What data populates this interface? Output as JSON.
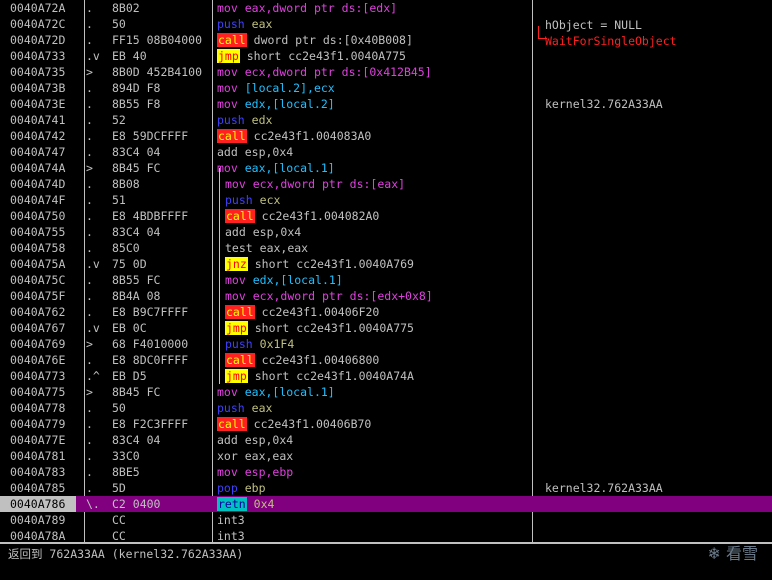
{
  "rows": [
    {
      "addr": "0040A72A",
      "mark": ".",
      "hex": "8B02",
      "mn": "mov",
      "ops": "eax,dword ptr ds:[edx]",
      "cls": "mov",
      "cmt": ""
    },
    {
      "addr": "0040A72C",
      "mark": ".",
      "hex": "50",
      "mn": "push",
      "ops": "eax",
      "cls": "push",
      "cmt": ""
    },
    {
      "addr": "0040A72D",
      "mark": ".",
      "hex": "FF15 08B04000",
      "mn": "call",
      "ops": "dword ptr ds:[0x40B008]",
      "cls": "call",
      "cmt": ""
    },
    {
      "addr": "0040A733",
      "mark": ".v",
      "hex": "EB 40",
      "mn": "jmp",
      "ops": "short cc2e43f1.0040A775",
      "cls": "jmp",
      "cmt": ""
    },
    {
      "addr": "0040A735",
      "mark": ">",
      "hex": "8B0D 452B4100",
      "mn": "mov",
      "ops": "ecx,dword ptr ds:[0x412B45]",
      "cls": "mov",
      "cmt": ""
    },
    {
      "addr": "0040A73B",
      "mark": ".",
      "hex": "894D F8",
      "mn": "mov",
      "ops": "[local.2],ecx",
      "cls": "mov",
      "cmt": ""
    },
    {
      "addr": "0040A73E",
      "mark": ".",
      "hex": "8B55 F8",
      "mn": "mov",
      "ops": "edx,[local.2]",
      "cls": "mov",
      "cmt": "kernel32.762A33AA"
    },
    {
      "addr": "0040A741",
      "mark": ".",
      "hex": "52",
      "mn": "push",
      "ops": "edx",
      "cls": "push",
      "cmt": ""
    },
    {
      "addr": "0040A742",
      "mark": ".",
      "hex": "E8 59DCFFFF",
      "mn": "call",
      "ops": "cc2e43f1.004083A0",
      "cls": "call",
      "cmt": ""
    },
    {
      "addr": "0040A747",
      "mark": ".",
      "hex": "83C4 04",
      "mn": "add",
      "ops": "esp,0x4",
      "cls": "add",
      "cmt": ""
    },
    {
      "addr": "0040A74A",
      "mark": ">",
      "hex": "8B45 FC",
      "mn": "mov",
      "ops": "eax,[local.1]",
      "cls": "mov",
      "cmt": ""
    },
    {
      "addr": "0040A74D",
      "mark": ".",
      "hex": "8B08",
      "mn": "mov",
      "ops": "ecx,dword ptr ds:[eax]",
      "cls": "mov",
      "cmt": ""
    },
    {
      "addr": "0040A74F",
      "mark": ".",
      "hex": "51",
      "mn": "push",
      "ops": "ecx",
      "cls": "push",
      "cmt": ""
    },
    {
      "addr": "0040A750",
      "mark": ".",
      "hex": "E8 4BDBFFFF",
      "mn": "call",
      "ops": "cc2e43f1.004082A0",
      "cls": "call",
      "cmt": ""
    },
    {
      "addr": "0040A755",
      "mark": ".",
      "hex": "83C4 04",
      "mn": "add",
      "ops": "esp,0x4",
      "cls": "add",
      "cmt": ""
    },
    {
      "addr": "0040A758",
      "mark": ".",
      "hex": "85C0",
      "mn": "test",
      "ops": "eax,eax",
      "cls": "test",
      "cmt": ""
    },
    {
      "addr": "0040A75A",
      "mark": ".v",
      "hex": "75 0D",
      "mn": "jnz",
      "ops": "short cc2e43f1.0040A769",
      "cls": "jcc",
      "cmt": ""
    },
    {
      "addr": "0040A75C",
      "mark": ".",
      "hex": "8B55 FC",
      "mn": "mov",
      "ops": "edx,[local.1]",
      "cls": "mov",
      "cmt": ""
    },
    {
      "addr": "0040A75F",
      "mark": ".",
      "hex": "8B4A 08",
      "mn": "mov",
      "ops": "ecx,dword ptr ds:[edx+0x8]",
      "cls": "mov",
      "cmt": ""
    },
    {
      "addr": "0040A762",
      "mark": ".",
      "hex": "E8 B9C7FFFF",
      "mn": "call",
      "ops": "cc2e43f1.00406F20",
      "cls": "call",
      "cmt": ""
    },
    {
      "addr": "0040A767",
      "mark": ".v",
      "hex": "EB 0C",
      "mn": "jmp",
      "ops": "short cc2e43f1.0040A775",
      "cls": "jmp",
      "cmt": ""
    },
    {
      "addr": "0040A769",
      "mark": ">",
      "hex": "68 F4010000",
      "mn": "push",
      "ops": "0x1F4",
      "cls": "push",
      "cmt": ""
    },
    {
      "addr": "0040A76E",
      "mark": ".",
      "hex": "E8 8DC0FFFF",
      "mn": "call",
      "ops": "cc2e43f1.00406800",
      "cls": "call",
      "cmt": ""
    },
    {
      "addr": "0040A773",
      "mark": ".^",
      "hex": "EB D5",
      "mn": "jmp",
      "ops": "short cc2e43f1.0040A74A",
      "cls": "jmp",
      "cmt": ""
    },
    {
      "addr": "0040A775",
      "mark": ">",
      "hex": "8B45 FC",
      "mn": "mov",
      "ops": "eax,[local.1]",
      "cls": "mov",
      "cmt": ""
    },
    {
      "addr": "0040A778",
      "mark": ".",
      "hex": "50",
      "mn": "push",
      "ops": "eax",
      "cls": "push",
      "cmt": ""
    },
    {
      "addr": "0040A779",
      "mark": ".",
      "hex": "E8 F2C3FFFF",
      "mn": "call",
      "ops": "cc2e43f1.00406B70",
      "cls": "call",
      "cmt": ""
    },
    {
      "addr": "0040A77E",
      "mark": ".",
      "hex": "83C4 04",
      "mn": "add",
      "ops": "esp,0x4",
      "cls": "add",
      "cmt": ""
    },
    {
      "addr": "0040A781",
      "mark": ".",
      "hex": "33C0",
      "mn": "xor",
      "ops": "eax,eax",
      "cls": "xor",
      "cmt": ""
    },
    {
      "addr": "0040A783",
      "mark": ".",
      "hex": "8BE5",
      "mn": "mov",
      "ops": "esp,ebp",
      "cls": "mov",
      "cmt": ""
    },
    {
      "addr": "0040A785",
      "mark": ".",
      "hex": "5D",
      "mn": "pop",
      "ops": "ebp",
      "cls": "push",
      "cmt": "kernel32.762A33AA"
    },
    {
      "addr": "0040A786",
      "mark": "\\.",
      "hex": "C2 0400",
      "mn": "retn",
      "ops": "0x4",
      "cls": "retn",
      "cmt": "",
      "selected": true
    },
    {
      "addr": "0040A789",
      "mark": "",
      "hex": "CC",
      "mn": "int3",
      "ops": "",
      "cls": "int3",
      "cmt": ""
    },
    {
      "addr": "0040A78A",
      "mark": "",
      "hex": "CC",
      "mn": "int3",
      "ops": "",
      "cls": "int3",
      "cmt": ""
    }
  ],
  "comments": {
    "hobject": "hObject = NULL",
    "wfso": "WaitForSingleObject"
  },
  "status": {
    "text": "返回到 762A33AA (kernel32.762A33AA)"
  },
  "watermark": "❄ 看雪",
  "colors": {
    "selected_row": "#800080",
    "call_bg": "#ff2020",
    "jmp_bg": "#ffff00",
    "retn_bg": "#00c0c0"
  }
}
